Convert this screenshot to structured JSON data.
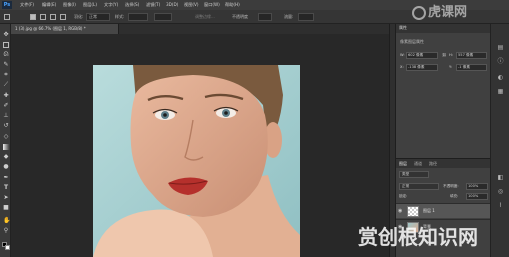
{
  "app": {
    "logo": "Ps"
  },
  "menu": [
    "文件(F)",
    "编辑(E)",
    "图像(I)",
    "图层(L)",
    "文字(Y)",
    "选择(S)",
    "滤镜(T)",
    "3D(D)",
    "视图(V)",
    "窗口(W)",
    "帮助(H)"
  ],
  "options": {
    "feather_label": "羽化:",
    "style_label": "样式:",
    "style_value": "正常",
    "refine_edge": "调整边缘...",
    "mode_label": "不透明度",
    "mode_value": "100%",
    "flow_label": "流量:",
    "flow_value": "100%"
  },
  "document": {
    "tab_title": "1 (3).jpg @ 66.7% (图层 1, RGB/8) *"
  },
  "tools": [
    "move-icon",
    "marquee-icon",
    "lasso-icon",
    "quick-select-icon",
    "crop-icon",
    "eyedropper-icon",
    "healing-icon",
    "brush-icon",
    "stamp-icon",
    "history-brush-icon",
    "eraser-icon",
    "gradient-icon",
    "blur-icon",
    "dodge-icon",
    "pen-icon",
    "type-icon",
    "path-select-icon",
    "shape-icon",
    "hand-icon",
    "zoom-icon"
  ],
  "properties": {
    "tab": "属性",
    "subtitle": "像素图层属性",
    "w_label": "W:",
    "w_value": "602 像素",
    "h_label": "H:",
    "h_value": "557 像素",
    "x_label": "X:",
    "x_value": "-138 像素",
    "y_label": "Y:",
    "y_value": "-1 像素"
  },
  "layers": {
    "tabs": [
      "图层",
      "通道",
      "路径"
    ],
    "kind_label": "类型",
    "blend_mode": "正常",
    "opacity_label": "不透明度:",
    "opacity_value": "100%",
    "fill_label": "填充:",
    "fill_value": "100%",
    "lock_label": "锁定:",
    "items": [
      {
        "name": "图层 1"
      },
      {
        "name": "背景"
      }
    ]
  },
  "watermark": {
    "top": "虎课网",
    "bottom": "赏创根知识网"
  }
}
